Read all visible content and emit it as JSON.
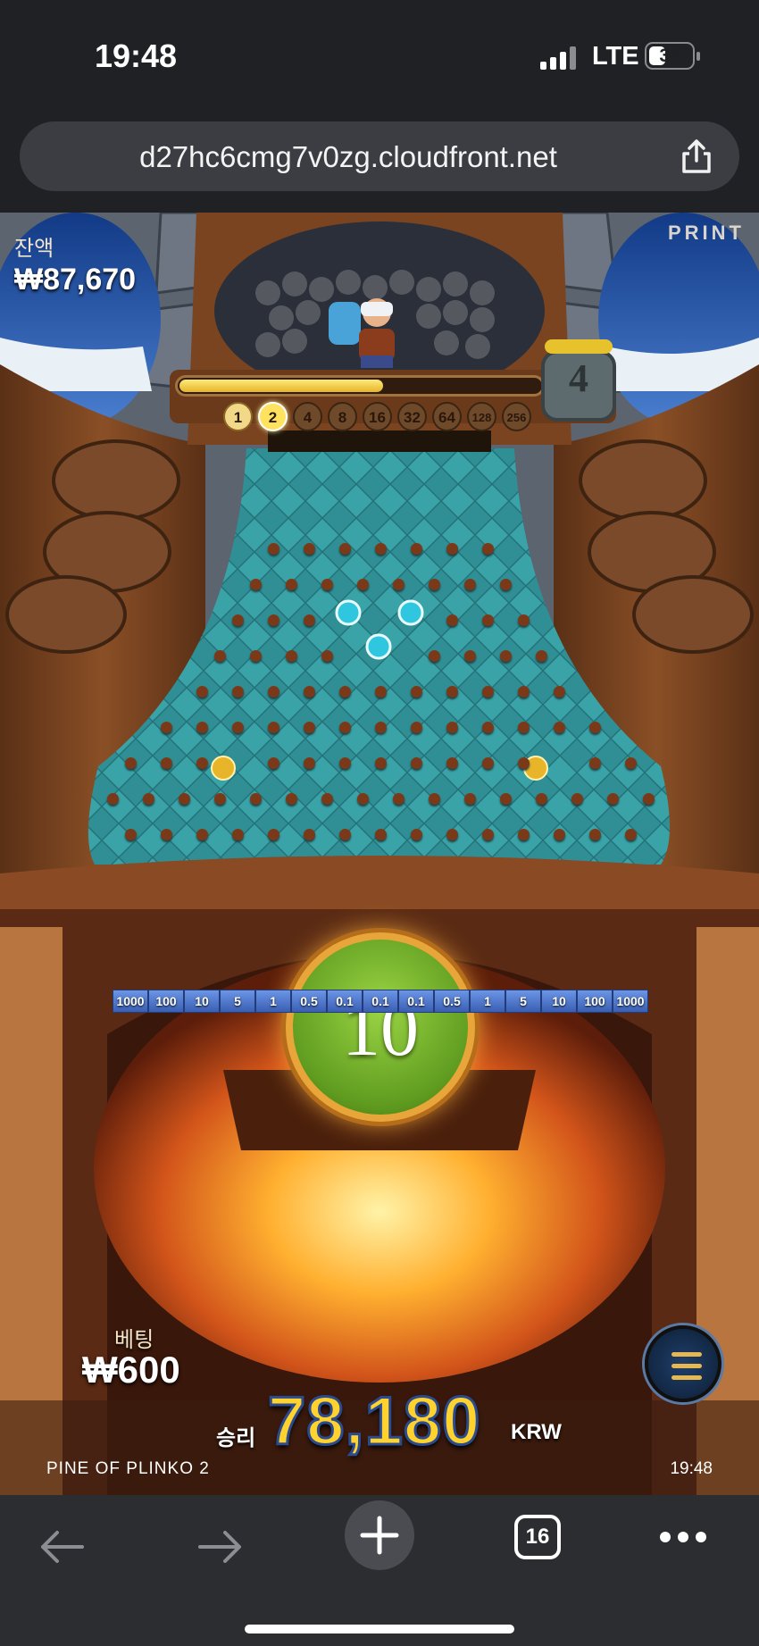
{
  "status_bar": {
    "time": "19:48",
    "network": "LTE",
    "battery": "34"
  },
  "browser": {
    "url": "d27hc6cmg7v0zg.cloudfront.net",
    "tab_count": "16"
  },
  "game": {
    "balance_label": "잔액",
    "balance_value": "₩87,670",
    "brand": "PRINT",
    "level": "4",
    "progress_fraction": 0.56,
    "multipliers": [
      "1",
      "2",
      "4",
      "8",
      "16",
      "32",
      "64",
      "128",
      "256"
    ],
    "active_multipliers": 2,
    "bucket_values": [
      "1000",
      "100",
      "10",
      "5",
      "1",
      "0.5",
      "0.1",
      "0.1",
      "0.1",
      "0.5",
      "1",
      "5",
      "10",
      "100",
      "1000"
    ],
    "play_count": "10",
    "bet_label": "베팅",
    "bet_value": "₩600",
    "win_label": "승리",
    "win_value": "78,180",
    "win_currency": "KRW",
    "game_name": "PINE OF PLINKO 2",
    "game_clock": "19:48"
  }
}
